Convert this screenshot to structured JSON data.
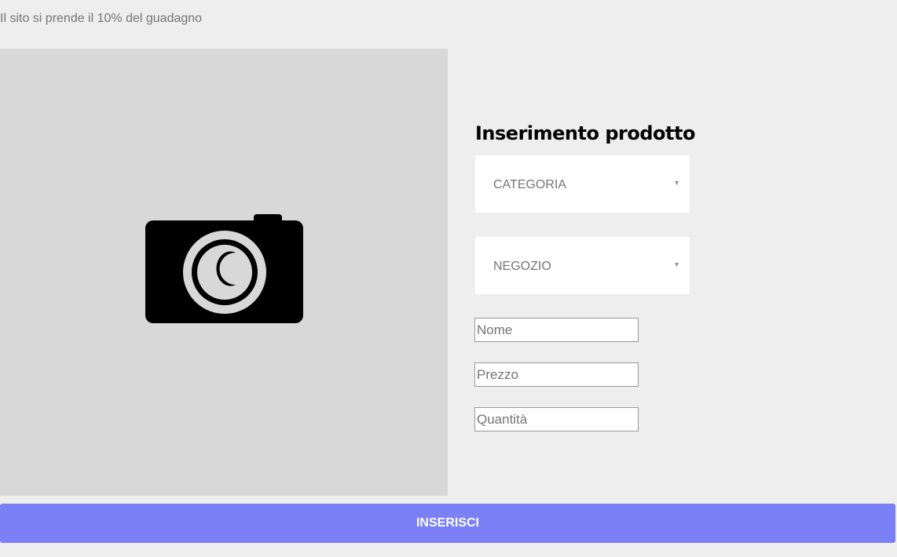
{
  "notice": "Il sito si prende il 10% del guadagno",
  "photo": {
    "icon": "camera-icon"
  },
  "form": {
    "title": "Inserimento prodotto",
    "category_select": {
      "value": "CATEGORIA",
      "icon": "chevron-down-icon"
    },
    "shop_select": {
      "value": "NEGOZIO",
      "icon": "chevron-down-icon"
    },
    "name_input": {
      "placeholder": "Nome",
      "value": ""
    },
    "price_input": {
      "placeholder": "Prezzo",
      "value": ""
    },
    "quantity_input": {
      "placeholder": "Quantità",
      "value": ""
    },
    "chevron_glyph": "❤"
  },
  "submit_label": "INSERISCI",
  "colors": {
    "accent": "#7b80f7",
    "background": "#eeeeee",
    "photo_bg": "#d8d8d8"
  }
}
